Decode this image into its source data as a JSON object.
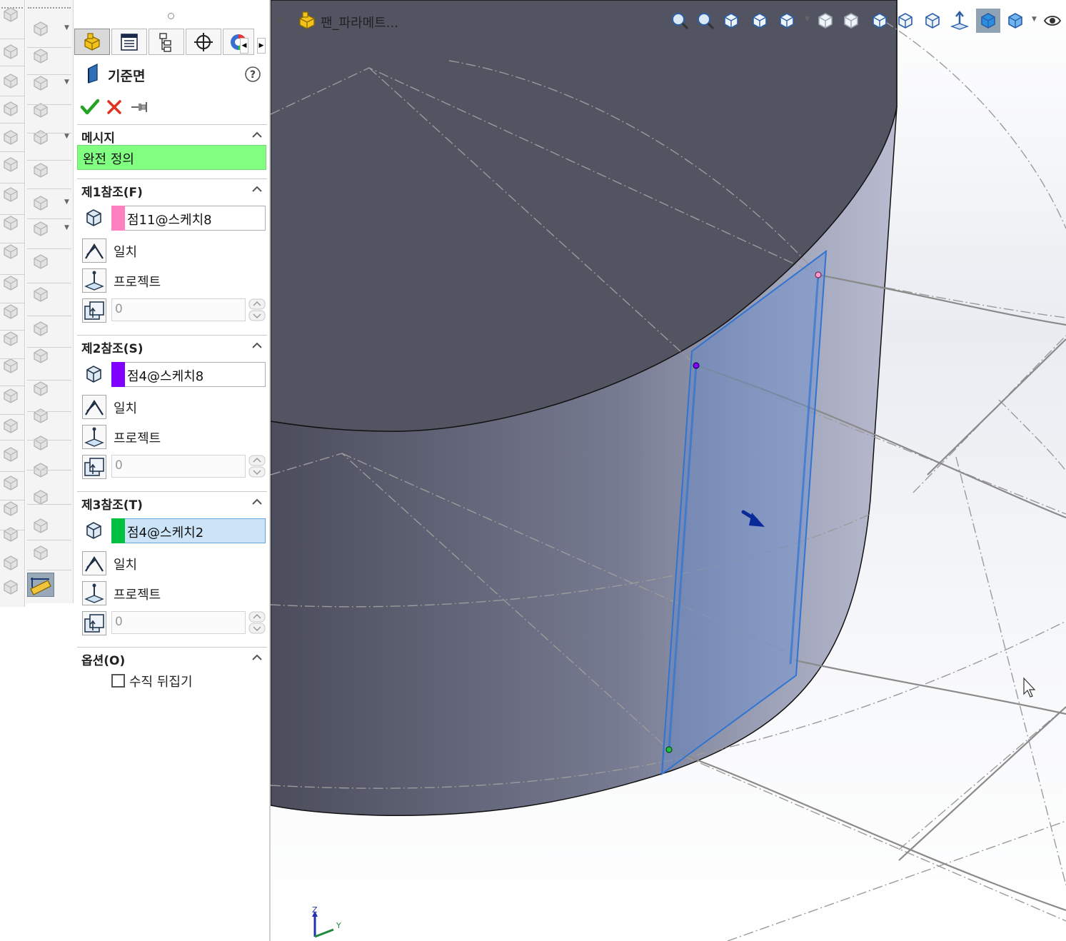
{
  "property_manager": {
    "tabs": [
      {
        "name": "featuremanager-tab",
        "icon": "part-tree-icon"
      },
      {
        "name": "propertymanager-tab",
        "icon": "property-list-icon"
      },
      {
        "name": "configurationmanager-tab",
        "icon": "configuration-icon"
      },
      {
        "name": "dimxpert-tab",
        "icon": "crosshair-icon"
      },
      {
        "name": "appearance-tab",
        "icon": "color-wheel-icon"
      }
    ],
    "title": "기준면",
    "help_icon": "question-icon",
    "actions": {
      "ok": "check-icon",
      "cancel": "close-icon",
      "pin": "pushpin-icon"
    },
    "message": {
      "header": "메시지",
      "text": "완전 정의",
      "color": "#80ff80"
    },
    "references": [
      {
        "header": "제1참조(F)",
        "value": "점11@스케치8",
        "swatch": "#ff80c0",
        "coincident": "일치",
        "project": "프로젝트",
        "distance": "0",
        "selected": false
      },
      {
        "header": "제2참조(S)",
        "value": "점4@스케치8",
        "swatch": "#8000ff",
        "coincident": "일치",
        "project": "프로젝트",
        "distance": "0",
        "selected": false
      },
      {
        "header": "제3참조(T)",
        "value": "점4@스케치2",
        "swatch": "#00c040",
        "coincident": "일치",
        "project": "프로젝트",
        "distance": "0",
        "selected": true
      }
    ],
    "options": {
      "header": "옵션(O)",
      "flip_normal": "수직 뒤집기",
      "flip_checked": false
    }
  },
  "viewport": {
    "breadcrumb": "팬_파라메트...",
    "hud_icons": [
      "zoom-to-fit-icon",
      "zoom-to-area-icon",
      "previous-view-icon",
      "section-view-icon",
      "view-orientation-icon",
      "display-style-icon",
      "hide-lines-icon",
      "wireframe-icon",
      "hidden-lines-visible-icon",
      "hidden-lines-removed-icon",
      "normal-to-icon",
      "shaded-icon",
      "shaded-with-edges-icon",
      "hide-show-items-icon"
    ],
    "triad_labels": {
      "z": "Z",
      "y": "Y"
    },
    "accent": "#1f5fb4"
  }
}
